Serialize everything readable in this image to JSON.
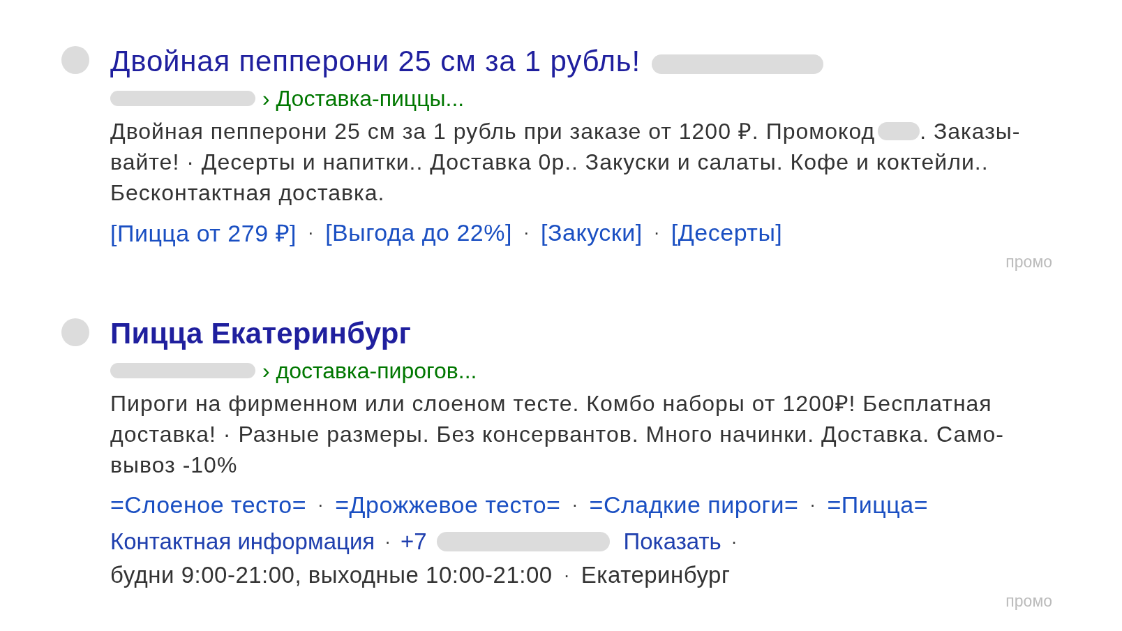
{
  "results": [
    {
      "title": "Двойная пепперони 25 см за 1 рубль!",
      "bold": false,
      "url_path": "› Доставка-пиццы...",
      "snippet": [
        [
          "Двойная пепперони 25 см за 1 рубль при заказе от 1200 ₽. Промокод",
          ". Заказы-"
        ],
        [
          "вайте! · Десерты и напитки.. Доставка 0р.. Закуски и салаты. Кофе и коктейли.."
        ],
        [
          "Бесконтактная доставка."
        ]
      ],
      "separator": "·",
      "sitelinks": [
        "[Пицца от 279 ₽]",
        "[Выгода до 22%]",
        "[Закуски]",
        "[Десерты]"
      ],
      "label": "промо"
    },
    {
      "title": "Пицца Екатеринбург",
      "bold": true,
      "url_path": "› доставка-пирогов...",
      "snippet": [
        [
          "Пироги на фирменном или слоеном тесте. Комбо наборы от 1200₽! Бесплатная"
        ],
        [
          "доставка! · Разные размеры. Без консервантов. Много начинки. Доставка. Само-"
        ],
        [
          "вывоз -10%"
        ]
      ],
      "separator": "·",
      "sitelinks": [
        "=Слоеное тесто=",
        "=Дрожжевое тесто=",
        "=Сладкие пироги=",
        "=Пицца="
      ],
      "contacts": {
        "link": "Контактная информация",
        "phone_prefix": "+7",
        "phone_action": "Показать",
        "hours": "будни 9:00-21:00, выходные 10:00-21:00",
        "city": "Екатеринбург"
      },
      "label": "промо"
    }
  ]
}
